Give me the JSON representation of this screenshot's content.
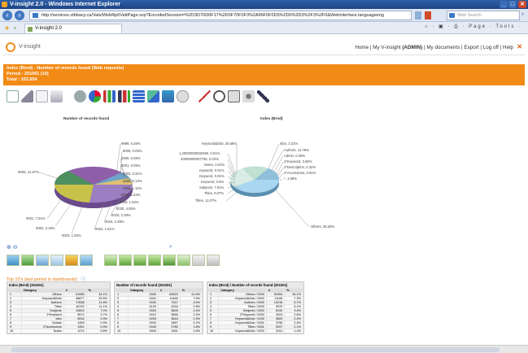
{
  "window": {
    "title": "V-insight 2.0 - Windows Internet Explorer",
    "minimize": "_",
    "maximize": "□",
    "close": "✕"
  },
  "browser": {
    "url": "http://services.vtbbavy.ca/Vats/WebRpt/VattPage.svp?EncodedSession=%2D3D70D0F17%2D0F70F0F3%2A96F0F0D5%2D0%2D3%2F3%2F0&WebInterface.languageeng",
    "search_placeholder": "Web Search",
    "tab_label": "V-insight 2.0",
    "tools": "⌂ · ▣ · ⎙ · Page · Tools ·"
  },
  "app": {
    "logo_text": "V-insight",
    "nav": {
      "home": "Home",
      "sep1": " | ",
      "my_vinsight": "My V-insight",
      "admin": "(ADMIN)",
      "sep2": " | ",
      "my_documents": "My documents",
      "sep3": " | ",
      "export": "Export",
      "sep4": " | ",
      "logoff": "Log off",
      "sep5": " | ",
      "help": "Help"
    },
    "banner": {
      "line1": "Index (Brnd) - Number of records found (Web requests)",
      "line2": "Period : 201001 (10)",
      "line3": "Total : 103,654"
    },
    "section_link": "Top 10's (last period in dashboards)",
    "zoom_icons": "⊕ ⊖"
  },
  "chart_data": [
    {
      "type": "pie",
      "title": "Number of records found",
      "labels": [
        "0000, 41.67%",
        "9999, 0.26%",
        "9005, 0.05%",
        "4000, 0.06%",
        "0001, 0.09%",
        "0003, 0.31%",
        "1000, 0.13%",
        "0250, 1.11%",
        "0150, 1.54%",
        "0040, 1.92%",
        "0030, 4.05%",
        "0020, 2.39%",
        "0019, 2.39%",
        "0004, 1.51%",
        "0003, 1.62%",
        "0002, 2.19%",
        "0001, 7.51%"
      ]
    },
    {
      "type": "pie",
      "title": "Index (Brnd)",
      "labels": [
        "Keyword&Dsb, 25.66%",
        "1,20000000000450, 0.01%",
        "20000000007755, 0.02%",
        "Notes, 0.01%",
        "Keyword, 0.01%",
        "Keyword, 0.01%",
        "Keyword, 0.6%",
        "Subjects, 7.81%",
        "Titles, 0.07%",
        "Titles, 11.07%",
        "Isbn, 3.31%",
        "Authors, 12.76%",
        "Admin, 0.26%",
        "2*Keyword, 3.66%",
        "2*Description, 0.32%",
        "2*Accessions, 0.91%",
        "*, 1.59%",
        "Others, 26.26%"
      ]
    }
  ],
  "tables": [
    {
      "title": "Index (Brnd) (201001)",
      "headers": [
        "",
        "Category",
        "#",
        "%"
      ],
      "rows": [
        [
          "1",
          "Others",
          "51995",
          "34.1%"
        ],
        [
          "2",
          "Keyword&Dsb",
          "38877",
          "25.5%"
        ],
        [
          "3",
          "Authors",
          "17638",
          "11.6%"
        ],
        [
          "4",
          "Titles",
          "16792",
          "11.1%"
        ],
        [
          "5",
          "Subjects",
          "10824",
          "7.0%"
        ],
        [
          "6",
          "2*Keyword",
          "5574",
          "3.7%"
        ],
        [
          "7",
          "Isbn",
          "5034",
          "3.3%"
        ],
        [
          "8",
          "Serials",
          "1459",
          "0.9%"
        ],
        [
          "9",
          "2*Accessions",
          "1391",
          "0.9%"
        ],
        [
          "10",
          "Notes",
          "1274",
          "0.8%"
        ]
      ]
    },
    {
      "title": "Number of records found (201001)",
      "headers": [
        "",
        "Category",
        "#",
        "%"
      ],
      "rows": [
        [
          "1",
          "0000",
          "63920",
          "41.6%"
        ],
        [
          "2",
          "0001",
          "11466",
          "7.5%"
        ],
        [
          "3",
          "0030",
          "7047",
          "4.6%"
        ],
        [
          "4",
          "0100",
          "4334",
          "2.8%"
        ],
        [
          "5",
          "0020",
          "3826",
          "2.4%"
        ],
        [
          "6",
          "0010",
          "3666",
          "2.4%"
        ],
        [
          "7",
          "0200",
          "3618",
          "2.3%"
        ],
        [
          "8",
          "0002",
          "3487",
          "2.2%"
        ],
        [
          "9",
          "0040",
          "2780",
          "1.8%"
        ],
        [
          "10",
          "0003",
          "2481",
          "1.6%"
        ]
      ]
    },
    {
      "title": "Index (Brnd) / Number of records found (201001)",
      "headers": [
        "",
        "Category",
        "#",
        "%"
      ],
      "rows": [
        [
          "1",
          "Others / 0000",
          "51994",
          "34.1%"
        ],
        [
          "2",
          "Keyword&Dsb / 0000",
          "11108",
          "7.3%"
        ],
        [
          "3",
          "Authors / 0000",
          "10216",
          "6.7%"
        ],
        [
          "4",
          "Titles / 0000",
          "9379",
          "6.1%"
        ],
        [
          "5",
          "Subjects / 0000",
          "5190",
          "3.4%"
        ],
        [
          "6",
          "2*Keyword / 0000",
          "4024",
          "2.6%"
        ],
        [
          "7",
          "Keyword&Dsb / 0030",
          "3600",
          "2.4%"
        ],
        [
          "8",
          "Keyword&Dsb / 0001",
          "3708",
          "2.4%"
        ],
        [
          "9",
          "Titles / 0001",
          "3197",
          "2.1%"
        ],
        [
          "10",
          "Keyword&Dsb / 0200",
          "2191",
          "1.4%"
        ]
      ]
    }
  ]
}
